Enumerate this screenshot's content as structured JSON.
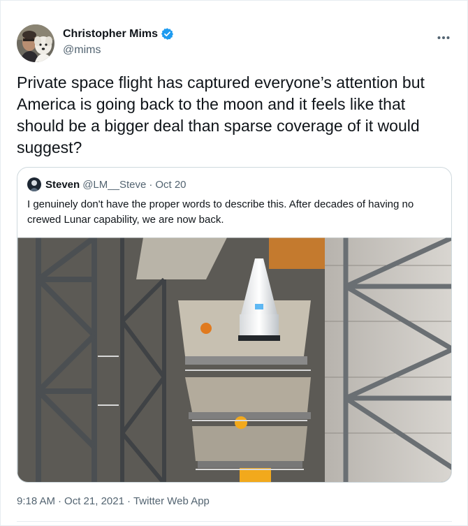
{
  "author": {
    "display_name": "Christopher Mims",
    "handle": "@mims",
    "verified": true,
    "avatar_icon": "author-avatar"
  },
  "more_icon": "more-options-icon",
  "tweet": {
    "text": "Private space flight has captured everyone’s attention but America is going back to the moon and it feels like that should be a bigger deal than sparse coverage of it would suggest?"
  },
  "quoted": {
    "display_name": "Steven",
    "handle": "@LM__Steve",
    "separator": "·",
    "date": "Oct 20",
    "text": "I genuinely don't have the proper words to describe this. After decades of having no crewed Lunar capability, we are now back.",
    "image_icon": "rocket-assembly-photo"
  },
  "meta": {
    "time": "9:18 AM",
    "sep1": "·",
    "date": "Oct 21, 2021",
    "sep2": "·",
    "source": "Twitter Web App"
  },
  "colors": {
    "verified_blue": "#1d9bf0",
    "secondary_text": "#536471",
    "border": "#cfd9de"
  }
}
